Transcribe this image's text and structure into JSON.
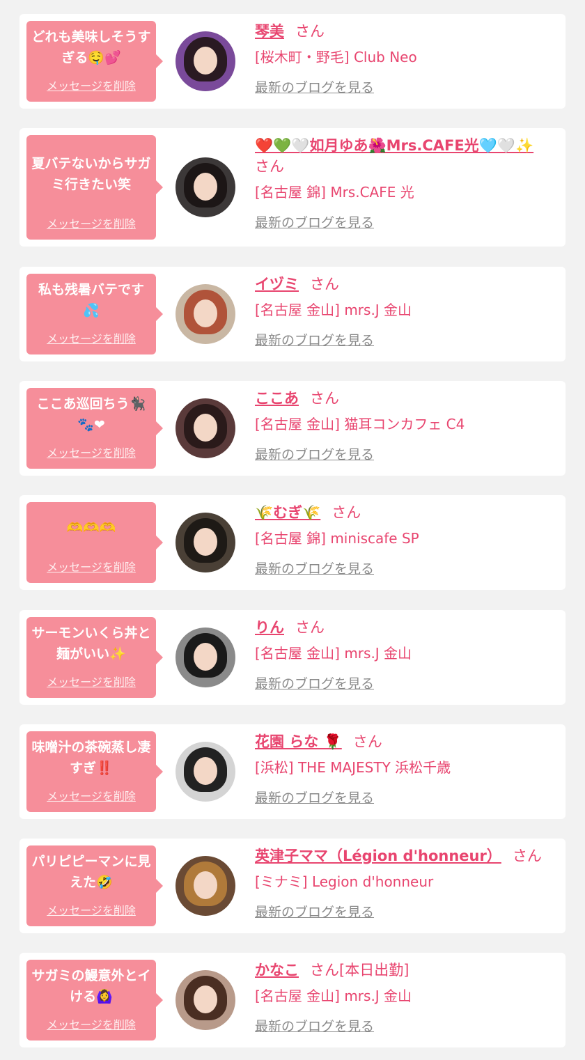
{
  "delete_label": "メッセージを削除",
  "san_label": "さん",
  "blog_label": "最新のブログを見る",
  "entries": [
    {
      "message": "どれも美味しそうすぎる🤤💕",
      "name": "琴美",
      "suffix": "",
      "shop": "[桜木町・野毛] Club Neo"
    },
    {
      "message": "夏バテないからサガミ行きたい笑",
      "name": "❤️💚🤍如月ゆあ🌺Mrs.CAFE光🩵🤍✨",
      "suffix": "",
      "shop": "[名古屋 錦] Mrs.CAFE 光"
    },
    {
      "message": "私も残暑バテです💦",
      "name": "イヅミ",
      "suffix": "",
      "shop": "[名古屋 金山] mrs.J 金山"
    },
    {
      "message": "ここあ巡回ちう🐈‍⬛🐾❤",
      "name": "ここあ",
      "suffix": "",
      "shop": "[名古屋 金山] 猫耳コンカフェ C4"
    },
    {
      "message": "🫶🫶🫶",
      "name": "🌾むぎ🌾",
      "suffix": "",
      "shop": "[名古屋 錦] miniscafe SP"
    },
    {
      "message": "サーモンいくら丼と麺がいい✨",
      "name": "りん",
      "suffix": "",
      "shop": "[名古屋 金山] mrs.J 金山"
    },
    {
      "message": "味噌汁の茶碗蒸し凄すぎ‼️",
      "name": "花園 らな 🌹",
      "suffix": "",
      "shop": "[浜松] THE MAJESTY 浜松千歳"
    },
    {
      "message": "パリピピーマンに見えた🤣",
      "name": "英津子ママ（Légion d'honneur）",
      "suffix": "",
      "shop": "[ミナミ] Legion d'honneur"
    },
    {
      "message": "サガミの鰻意外とイける🙆‍♀️",
      "name": "かなこ",
      "suffix": "[本日出勤]",
      "shop": "[名古屋 金山] mrs.J 金山"
    }
  ],
  "colors": {
    "accent": "#e8456f",
    "bubble": "#f68e9a",
    "card": "#ffffff",
    "background": "#f2f2f2",
    "link_gray": "#8a8a8a"
  }
}
